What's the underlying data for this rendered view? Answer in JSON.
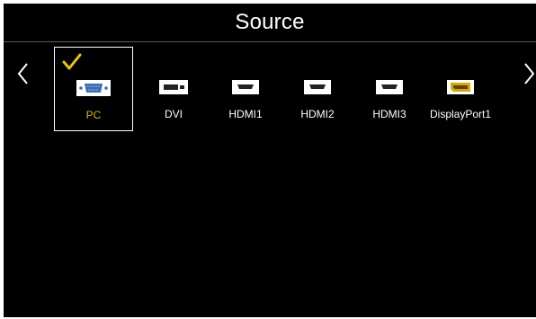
{
  "window": {
    "title": "Source"
  },
  "navigation": {
    "prev_icon": "chevron-left-icon",
    "next_icon": "chevron-right-icon"
  },
  "sources": [
    {
      "label": "PC",
      "icon": "vga-port-icon",
      "selected": true
    },
    {
      "label": "DVI",
      "icon": "dvi-port-icon",
      "selected": false
    },
    {
      "label": "HDMI1",
      "icon": "hdmi-port-icon",
      "selected": false
    },
    {
      "label": "HDMI2",
      "icon": "hdmi-port-icon",
      "selected": false
    },
    {
      "label": "HDMI3",
      "icon": "hdmi-port-icon",
      "selected": false
    },
    {
      "label": "DisplayPort1",
      "icon": "displayport-icon",
      "selected": false
    }
  ],
  "selection_indicator": "checkmark-icon",
  "colors": {
    "background": "#000000",
    "text": "#ffffff",
    "selected_text": "#e0b400",
    "checkmark": "#f2c200",
    "displayport_accent": "#d9a800"
  }
}
